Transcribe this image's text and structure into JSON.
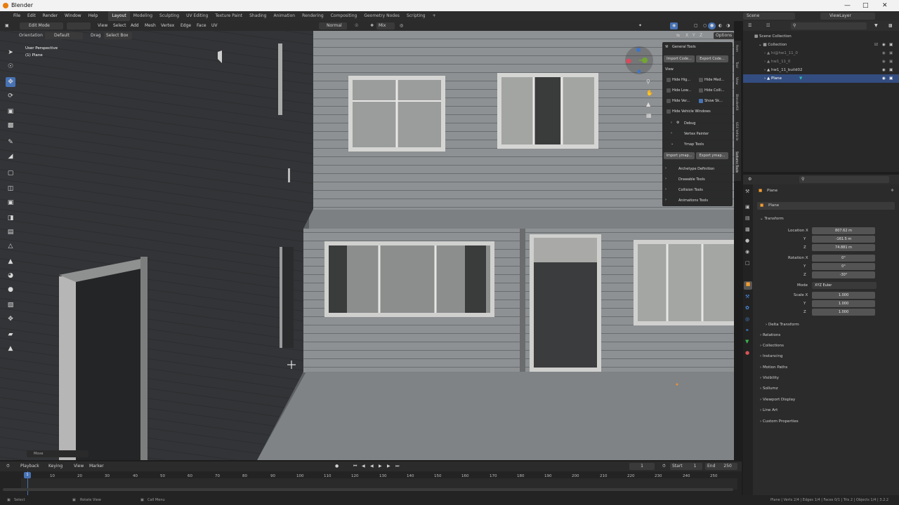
{
  "app": {
    "title": "Blender"
  },
  "menu": {
    "items": [
      "File",
      "Edit",
      "Render",
      "Window",
      "Help"
    ],
    "workspaces": [
      "Layout",
      "Modeling",
      "Sculpting",
      "UV Editing",
      "Texture Paint",
      "Shading",
      "Animation",
      "Rendering",
      "Compositing",
      "Geometry Nodes",
      "Scripting"
    ],
    "active_workspace": "Layout",
    "add_tab": "+",
    "scene": "Scene",
    "view_layer": "ViewLayer"
  },
  "viewport_header": {
    "mode": "Edit Mode",
    "menus": [
      "View",
      "Select",
      "Add",
      "Mesh",
      "Vertex",
      "Edge",
      "Face",
      "UV"
    ],
    "orientation_label": "Orientation",
    "orientation_value": "Default",
    "drag_label": "Drag",
    "drag_value": "Select Box",
    "transform_orientation": "Normal",
    "snap": "Mix",
    "options": "Options",
    "xyz": [
      "X",
      "Y",
      "Z"
    ]
  },
  "viewport": {
    "perspective": "User Perspective",
    "object": "(1) Plane",
    "last_op": "Move"
  },
  "npanel": {
    "general_tools": "General Tools",
    "import_code": "Import Code...",
    "export_code": "Export Code...",
    "view_label": "View",
    "checks": [
      {
        "label": "Hide Hig...",
        "on": false
      },
      {
        "label": "Hide Med...",
        "on": false
      },
      {
        "label": "Hide Low...",
        "on": false
      },
      {
        "label": "Hide Colli...",
        "on": false
      },
      {
        "label": "Hide Ver...",
        "on": false
      },
      {
        "label": "Show Sk...",
        "on": true
      },
      {
        "label": "Hide Vehicle Windows",
        "on": false
      }
    ],
    "debug": "Debug",
    "vertex_painter": "Vertex Painter",
    "ymap_tools": "Ymap Tools",
    "import_ymap": "Import ymap...",
    "export_ymap": "Export ymap...",
    "sections": [
      "Archetype Definition",
      "Drawable Tools",
      "Collision Tools",
      "Animations Tools"
    ],
    "tabs": [
      "Item",
      "Tool",
      "View",
      "BlenderKit",
      "UE4 Vehicle",
      "Sollumz Tools"
    ]
  },
  "outliner": {
    "search_placeholder": "",
    "rows": [
      {
        "label": "Scene Collection",
        "indent": 0,
        "selected": false
      },
      {
        "label": "Collection",
        "indent": 1,
        "selected": false
      },
      {
        "label": "hi@hw1_11_0",
        "indent": 2,
        "selected": false
      },
      {
        "label": "hw1_11_0",
        "indent": 2,
        "selected": false
      },
      {
        "label": "hw1_11_build02",
        "indent": 2,
        "selected": false
      },
      {
        "label": "Plane",
        "indent": 2,
        "selected": true
      }
    ]
  },
  "properties": {
    "object_name": "Plane",
    "data_name": "Plane",
    "transform": "Transform",
    "location_label": "Location X",
    "location": [
      "807.62 m",
      "-161.5 m",
      "74.881 m"
    ],
    "rotation_label": "Rotation X",
    "rotation": [
      "0°",
      "0°",
      "-30°"
    ],
    "mode_label": "Mode",
    "mode_value": "XYZ Euler",
    "scale_label": "Scale X",
    "scale": [
      "1.000",
      "1.000",
      "1.000"
    ],
    "axis_y": "Y",
    "axis_z": "Z",
    "delta": "Delta Transform",
    "sections": [
      "Relations",
      "Collections",
      "Instancing",
      "Motion Paths",
      "Visibility",
      "Sollumz",
      "Viewport Display",
      "Line Art",
      "Custom Properties"
    ]
  },
  "timeline": {
    "menus": [
      "Playback",
      "Keying",
      "View",
      "Marker"
    ],
    "current_frame": "1",
    "start_label": "Start",
    "start": "1",
    "end_label": "End",
    "end": "250",
    "ticks": [
      "1",
      "10",
      "20",
      "30",
      "40",
      "50",
      "60",
      "70",
      "80",
      "90",
      "100",
      "110",
      "120",
      "130",
      "140",
      "150",
      "160",
      "170",
      "180",
      "190",
      "200",
      "210",
      "220",
      "230",
      "240",
      "250"
    ]
  },
  "status": {
    "select": "Select",
    "rotate": "Rotate View",
    "call_menu": "Call Menu",
    "stats": "Plane | Verts 2/4 | Edges 1/4 | Faces 0/1 | Tris 2 | Objects 1/4 | 3.2.2"
  },
  "colors": {
    "accent": "#4772b3",
    "brand": "#e87d0d",
    "selection": "#334d80"
  }
}
